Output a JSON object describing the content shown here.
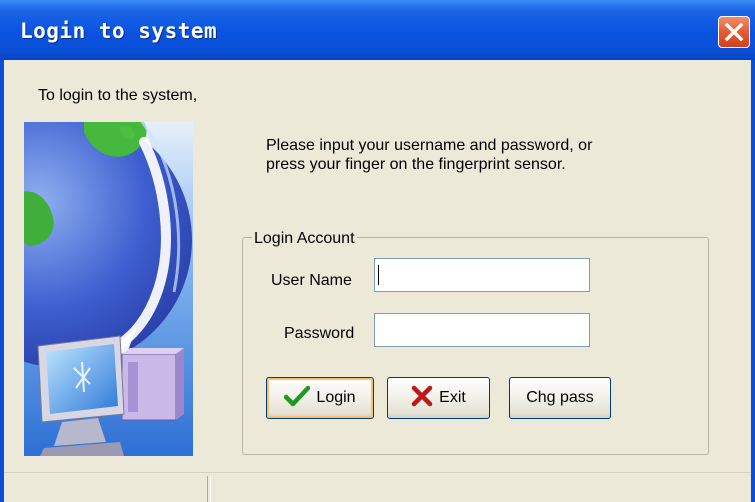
{
  "window": {
    "title": "Login to system",
    "close_label": "Close"
  },
  "intro_text": "To login to the system,",
  "instructions": {
    "line1": "Please input your username and password, or",
    "line2": "press your finger on the fingerprint sensor."
  },
  "login_account": {
    "group_label": "Login Account",
    "username_label": "User Name",
    "username_value": "",
    "password_label": "Password",
    "password_value": ""
  },
  "buttons": {
    "login_label": "Login",
    "exit_label": "Exit",
    "change_password_label": "Chg pass"
  },
  "icons": {
    "close": "close-icon",
    "login": "checkmark-icon",
    "exit": "x-mark-icon",
    "side_image": "globe-computer-illustration"
  },
  "colors": {
    "title_bar": "#0a4fd6",
    "window_background": "#ece9d8",
    "close_button": "#e55b33",
    "checkmark": "#1e9a1e",
    "x_mark": "#c01818"
  }
}
